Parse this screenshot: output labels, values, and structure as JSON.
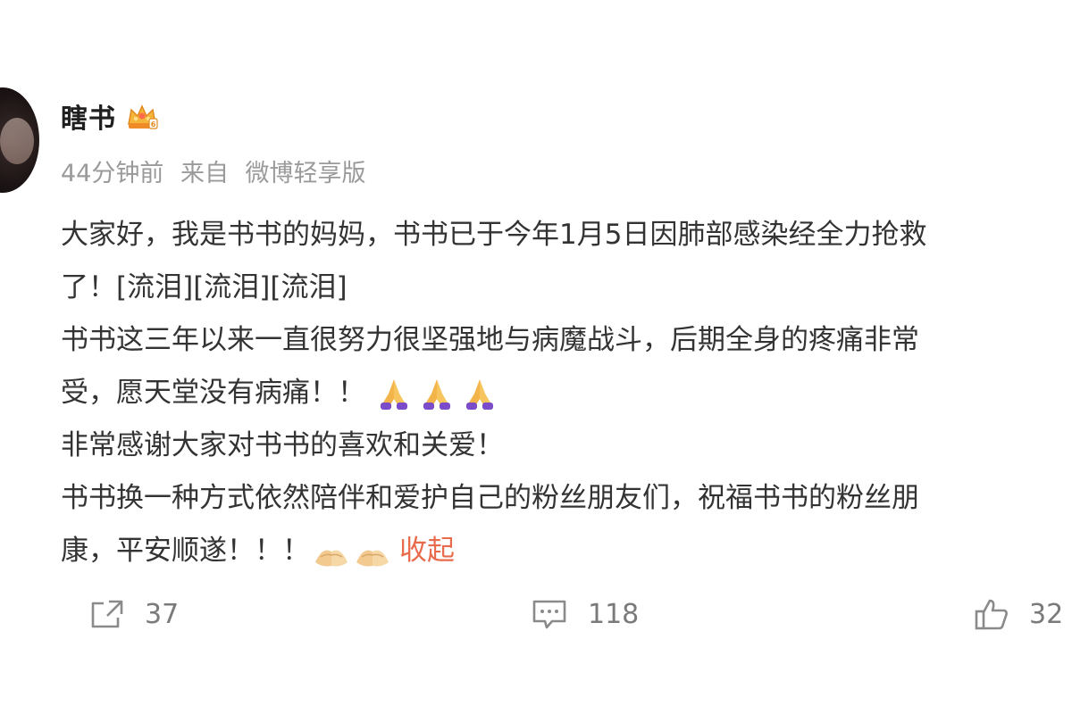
{
  "post": {
    "username": "瞎书",
    "meta": {
      "time": "44分钟前",
      "source_prefix": "来自",
      "source": "微博轻享版"
    },
    "lines": [
      "大家好，我是书书的妈妈，书书已于今年1月5日因肺部感染经全力抢救",
      "了！[流泪][流泪][流泪]",
      "书书这三年以来一直很努力很坚强地与病魔战斗，后期全身的疼痛非常",
      "受，愿天堂没有病痛！！",
      "非常感谢大家对书书的喜欢和关爱！",
      "书书换一种方式依然陪伴和爱护自己的粉丝朋友们，祝福书书的粉丝朋",
      "康，平安顺遂！！！"
    ],
    "collapse_label": "收起"
  },
  "actions": {
    "share_count": "37",
    "comment_count": "118",
    "like_count": "32"
  },
  "icons": {
    "badge": "crown-badge-icon",
    "pray": "folded-hands-icon",
    "hands": "palms-together-icon",
    "share": "share-icon",
    "comment": "comment-icon",
    "like": "thumbs-up-icon"
  },
  "colors": {
    "collapse_link": "#e86b4c",
    "meta_text": "#9a9a9a",
    "action_gray": "#7a7a7a"
  }
}
